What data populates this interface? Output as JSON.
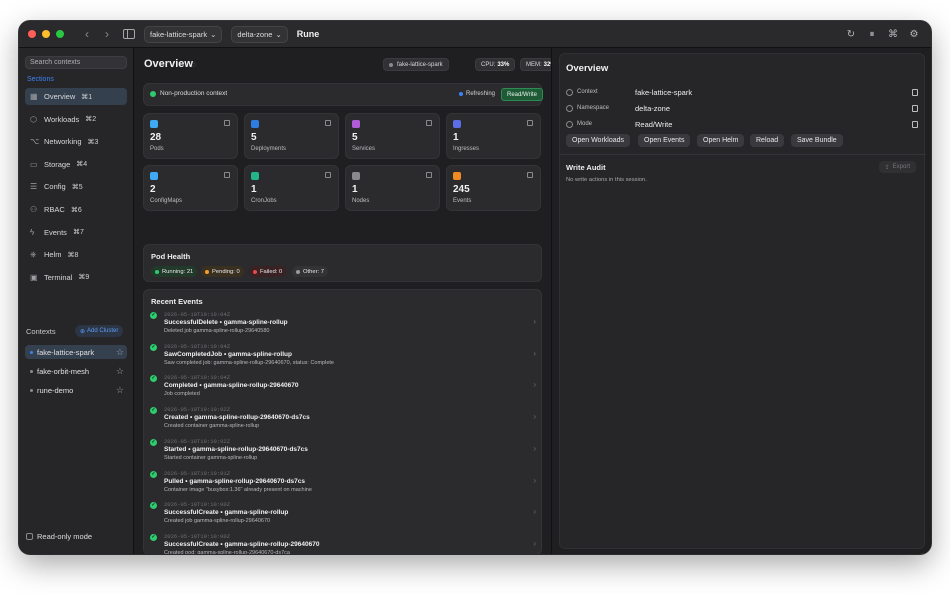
{
  "app": {
    "title": "Rune",
    "context_select": "fake-lattice-spark",
    "zone_select": "delta-zone"
  },
  "sidebar": {
    "search_placeholder": "Search contexts",
    "section_label": "Sections",
    "items": [
      {
        "icon": "grid-icon",
        "label": "Overview",
        "shortcut": "⌘1"
      },
      {
        "icon": "cube-icon",
        "label": "Workloads",
        "shortcut": "⌘2"
      },
      {
        "icon": "network-icon",
        "label": "Networking",
        "shortcut": "⌘3"
      },
      {
        "icon": "storage-icon",
        "label": "Storage",
        "shortcut": "⌘4"
      },
      {
        "icon": "config-icon",
        "label": "Config",
        "shortcut": "⌘5"
      },
      {
        "icon": "users-icon",
        "label": "RBAC",
        "shortcut": "⌘6"
      },
      {
        "icon": "bolt-icon",
        "label": "Events",
        "shortcut": "⌘7"
      },
      {
        "icon": "helm-icon",
        "label": "Helm",
        "shortcut": "⌘8"
      },
      {
        "icon": "terminal-icon",
        "label": "Terminal",
        "shortcut": "⌘9"
      }
    ],
    "contexts_label": "Contexts",
    "add_cluster": "Add Cluster",
    "contexts": [
      "fake-lattice-spark",
      "fake-orbit-mesh",
      "rune-demo"
    ],
    "read_only": "Read-only mode"
  },
  "overview": {
    "title": "Overview",
    "context_chip": "fake-lattice-spark",
    "cpu_label": "CPU:",
    "cpu_value": "33%",
    "mem_label": "MEM:",
    "mem_value": "32%",
    "non_production": "Non-production context",
    "refreshing": "Refreshing",
    "mode_badge": "Read/Write",
    "stats": [
      {
        "value": "28",
        "label": "Pods",
        "color": "#3fa9f5"
      },
      {
        "value": "5",
        "label": "Deployments",
        "color": "#2f7de1"
      },
      {
        "value": "5",
        "label": "Services",
        "color": "#b05cd6"
      },
      {
        "value": "1",
        "label": "Ingresses",
        "color": "#5b6ee8"
      },
      {
        "value": "2",
        "label": "ConfigMaps",
        "color": "#3fa9f5"
      },
      {
        "value": "1",
        "label": "CronJobs",
        "color": "#25b58a"
      },
      {
        "value": "1",
        "label": "Nodes",
        "color": "#8a8a8e"
      },
      {
        "value": "245",
        "label": "Events",
        "color": "#f08a24"
      }
    ],
    "pod_health_title": "Pod Health",
    "pod_health": [
      {
        "label": "Running: 21",
        "color": "#2ecc71",
        "bg": "#213a2a"
      },
      {
        "label": "Pending: 0",
        "color": "#f0a030",
        "bg": "#3a3020"
      },
      {
        "label": "Failed: 0",
        "color": "#e5484d",
        "bg": "#3a2224"
      },
      {
        "label": "Other: 7",
        "color": "#9a9a9e",
        "bg": "#333336"
      }
    ],
    "recent_events_title": "Recent Events",
    "events": [
      {
        "ts": "2026-05-18T19:10:04Z",
        "head": "SuccessfulDelete • gamma-spline-rollup",
        "detail": "Deleted job gamma-spline-rollup-29640580"
      },
      {
        "ts": "2026-05-18T19:10:04Z",
        "head": "SawCompletedJob • gamma-spline-rollup",
        "detail": "Saw completed job: gamma-spline-rollup-29640670, status: Complete"
      },
      {
        "ts": "2026-05-18T19:10:04Z",
        "head": "Completed • gamma-spline-rollup-29640670",
        "detail": "Job completed"
      },
      {
        "ts": "2026-05-18T19:10:02Z",
        "head": "Created • gamma-spline-rollup-29640670-ds7cs",
        "detail": "Created container gamma-spline-rollup"
      },
      {
        "ts": "2026-05-18T19:10:02Z",
        "head": "Started • gamma-spline-rollup-29640670-ds7cs",
        "detail": "Started container gamma-spline-rollup"
      },
      {
        "ts": "2026-05-18T19:10:01Z",
        "head": "Pulled • gamma-spline-rollup-29640670-ds7cs",
        "detail": "Container image \"busybox:1.36\" already present on machine"
      },
      {
        "ts": "2026-05-18T19:10:00Z",
        "head": "SuccessfulCreate • gamma-spline-rollup",
        "detail": "Created job gamma-spline-rollup-29640670"
      },
      {
        "ts": "2026-05-18T19:10:00Z",
        "head": "SuccessfulCreate • gamma-spline-rollup-29640670",
        "detail": "Created pod: gamma-spline-rollup-29640670-ds7ca"
      }
    ]
  },
  "detail": {
    "title": "Overview",
    "rows": [
      {
        "key": "Context",
        "value": "fake-lattice-spark"
      },
      {
        "key": "Namespace",
        "value": "delta-zone"
      },
      {
        "key": "Mode",
        "value": "Read/Write"
      }
    ],
    "actions": [
      "Open Workloads",
      "Open Events",
      "Open Helm",
      "Reload",
      "Save Bundle"
    ],
    "write_audit_title": "Write Audit",
    "export": "Export",
    "empty": "No write actions in this session."
  }
}
